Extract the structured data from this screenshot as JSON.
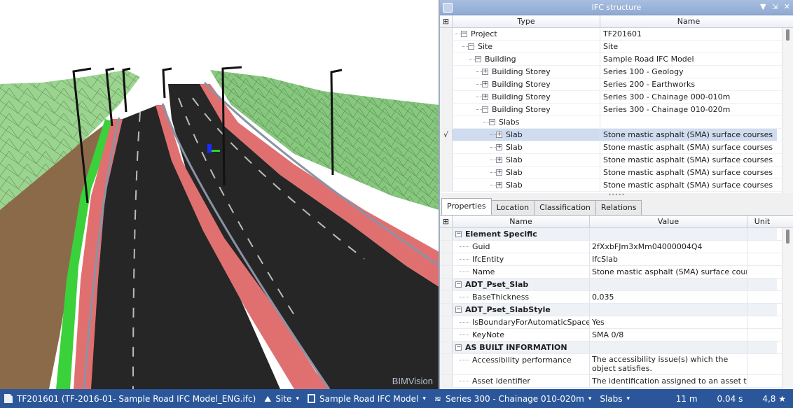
{
  "viewport": {
    "watermark": "BIMVision"
  },
  "ifc_panel": {
    "title": "IFC structure",
    "controls": [
      "▼",
      "⇲",
      "✕"
    ],
    "columns": {
      "gutter": "⊞",
      "type": "Type",
      "name": "Name"
    },
    "rows": [
      {
        "type": "Project",
        "name": "TF201601",
        "expander": "−",
        "check": ""
      },
      {
        "type": "Site",
        "name": "Site",
        "expander": "−",
        "check": ""
      },
      {
        "type": "Building",
        "name": "Sample Road IFC Model",
        "expander": "−",
        "check": ""
      },
      {
        "type": "Building Storey",
        "name": "Series 100 - Geology",
        "expander": "+",
        "check": ""
      },
      {
        "type": "Building Storey",
        "name": "Series 200 - Earthworks",
        "expander": "+",
        "check": ""
      },
      {
        "type": "Building Storey",
        "name": "Series 300 - Chainage 000-010m",
        "expander": "+",
        "check": ""
      },
      {
        "type": "Building Storey",
        "name": "Series 300 - Chainage 010-020m",
        "expander": "−",
        "check": ""
      },
      {
        "type": "Slabs",
        "name": "",
        "expander": "−",
        "check": ""
      },
      {
        "type": "Slab",
        "name": "Stone mastic asphalt (SMA) surface courses",
        "expander": "+",
        "check": "√"
      },
      {
        "type": "Slab",
        "name": "Stone mastic asphalt (SMA) surface courses",
        "expander": "+",
        "check": ""
      },
      {
        "type": "Slab",
        "name": "Stone mastic asphalt (SMA) surface courses",
        "expander": "+",
        "check": ""
      },
      {
        "type": "Slab",
        "name": "Stone mastic asphalt (SMA) surface courses",
        "expander": "+",
        "check": ""
      },
      {
        "type": "Slab",
        "name": "Stone mastic asphalt (SMA) surface courses",
        "expander": "+",
        "check": ""
      }
    ],
    "splitter": "•••••"
  },
  "tabs": [
    "Properties",
    "Location",
    "Classification",
    "Relations"
  ],
  "properties": {
    "columns": {
      "gutter": "⊞",
      "name": "Name",
      "value": "Value",
      "unit": "Unit"
    },
    "rows": [
      {
        "group": true,
        "name": "Element Specific",
        "value": "",
        "unit": ""
      },
      {
        "group": false,
        "name": "Guid",
        "value": "2fXxbFJm3xMm04000004Q4",
        "unit": ""
      },
      {
        "group": false,
        "name": "IfcEntity",
        "value": "IfcSlab",
        "unit": ""
      },
      {
        "group": false,
        "name": "Name",
        "value": "Stone mastic asphalt (SMA) surface courses",
        "unit": ""
      },
      {
        "group": true,
        "name": "ADT_Pset_Slab",
        "value": "",
        "unit": ""
      },
      {
        "group": false,
        "name": "BaseThickness",
        "value": "0,035",
        "unit": ""
      },
      {
        "group": true,
        "name": "ADT_Pset_SlabStyle",
        "value": "",
        "unit": ""
      },
      {
        "group": false,
        "name": "IsBoundaryForAutomaticSpaces",
        "value": "Yes",
        "unit": ""
      },
      {
        "group": false,
        "name": "KeyNote",
        "value": "SMA 0/8",
        "unit": ""
      },
      {
        "group": true,
        "name": "AS BUILT INFORMATION",
        "value": "",
        "unit": ""
      },
      {
        "group": false,
        "name": "Accessibility performance",
        "value": "The accessibility issue(s) which the object satisfies.",
        "unit": ""
      },
      {
        "group": false,
        "name": "Asset identifier",
        "value": "The identification assigned to an asset that",
        "unit": ""
      }
    ]
  },
  "status_bar": {
    "file": "TF201601 (TF-2016-01- Sample Road IFC Model_ENG.ifc)",
    "site": "Site",
    "building": "Sample Road IFC Model",
    "storey": "Series 300 - Chainage 010-020m",
    "category": "Slabs",
    "distance": "11 m",
    "time": "0.04 s",
    "rating": "4,8 ★",
    "caret": "▾"
  },
  "colors": {
    "accent": "#2b579a",
    "terrain": "#8fd18a",
    "asphalt": "#2a2a2a",
    "kerb": "#e07070",
    "selection": "#cfdcf0"
  }
}
